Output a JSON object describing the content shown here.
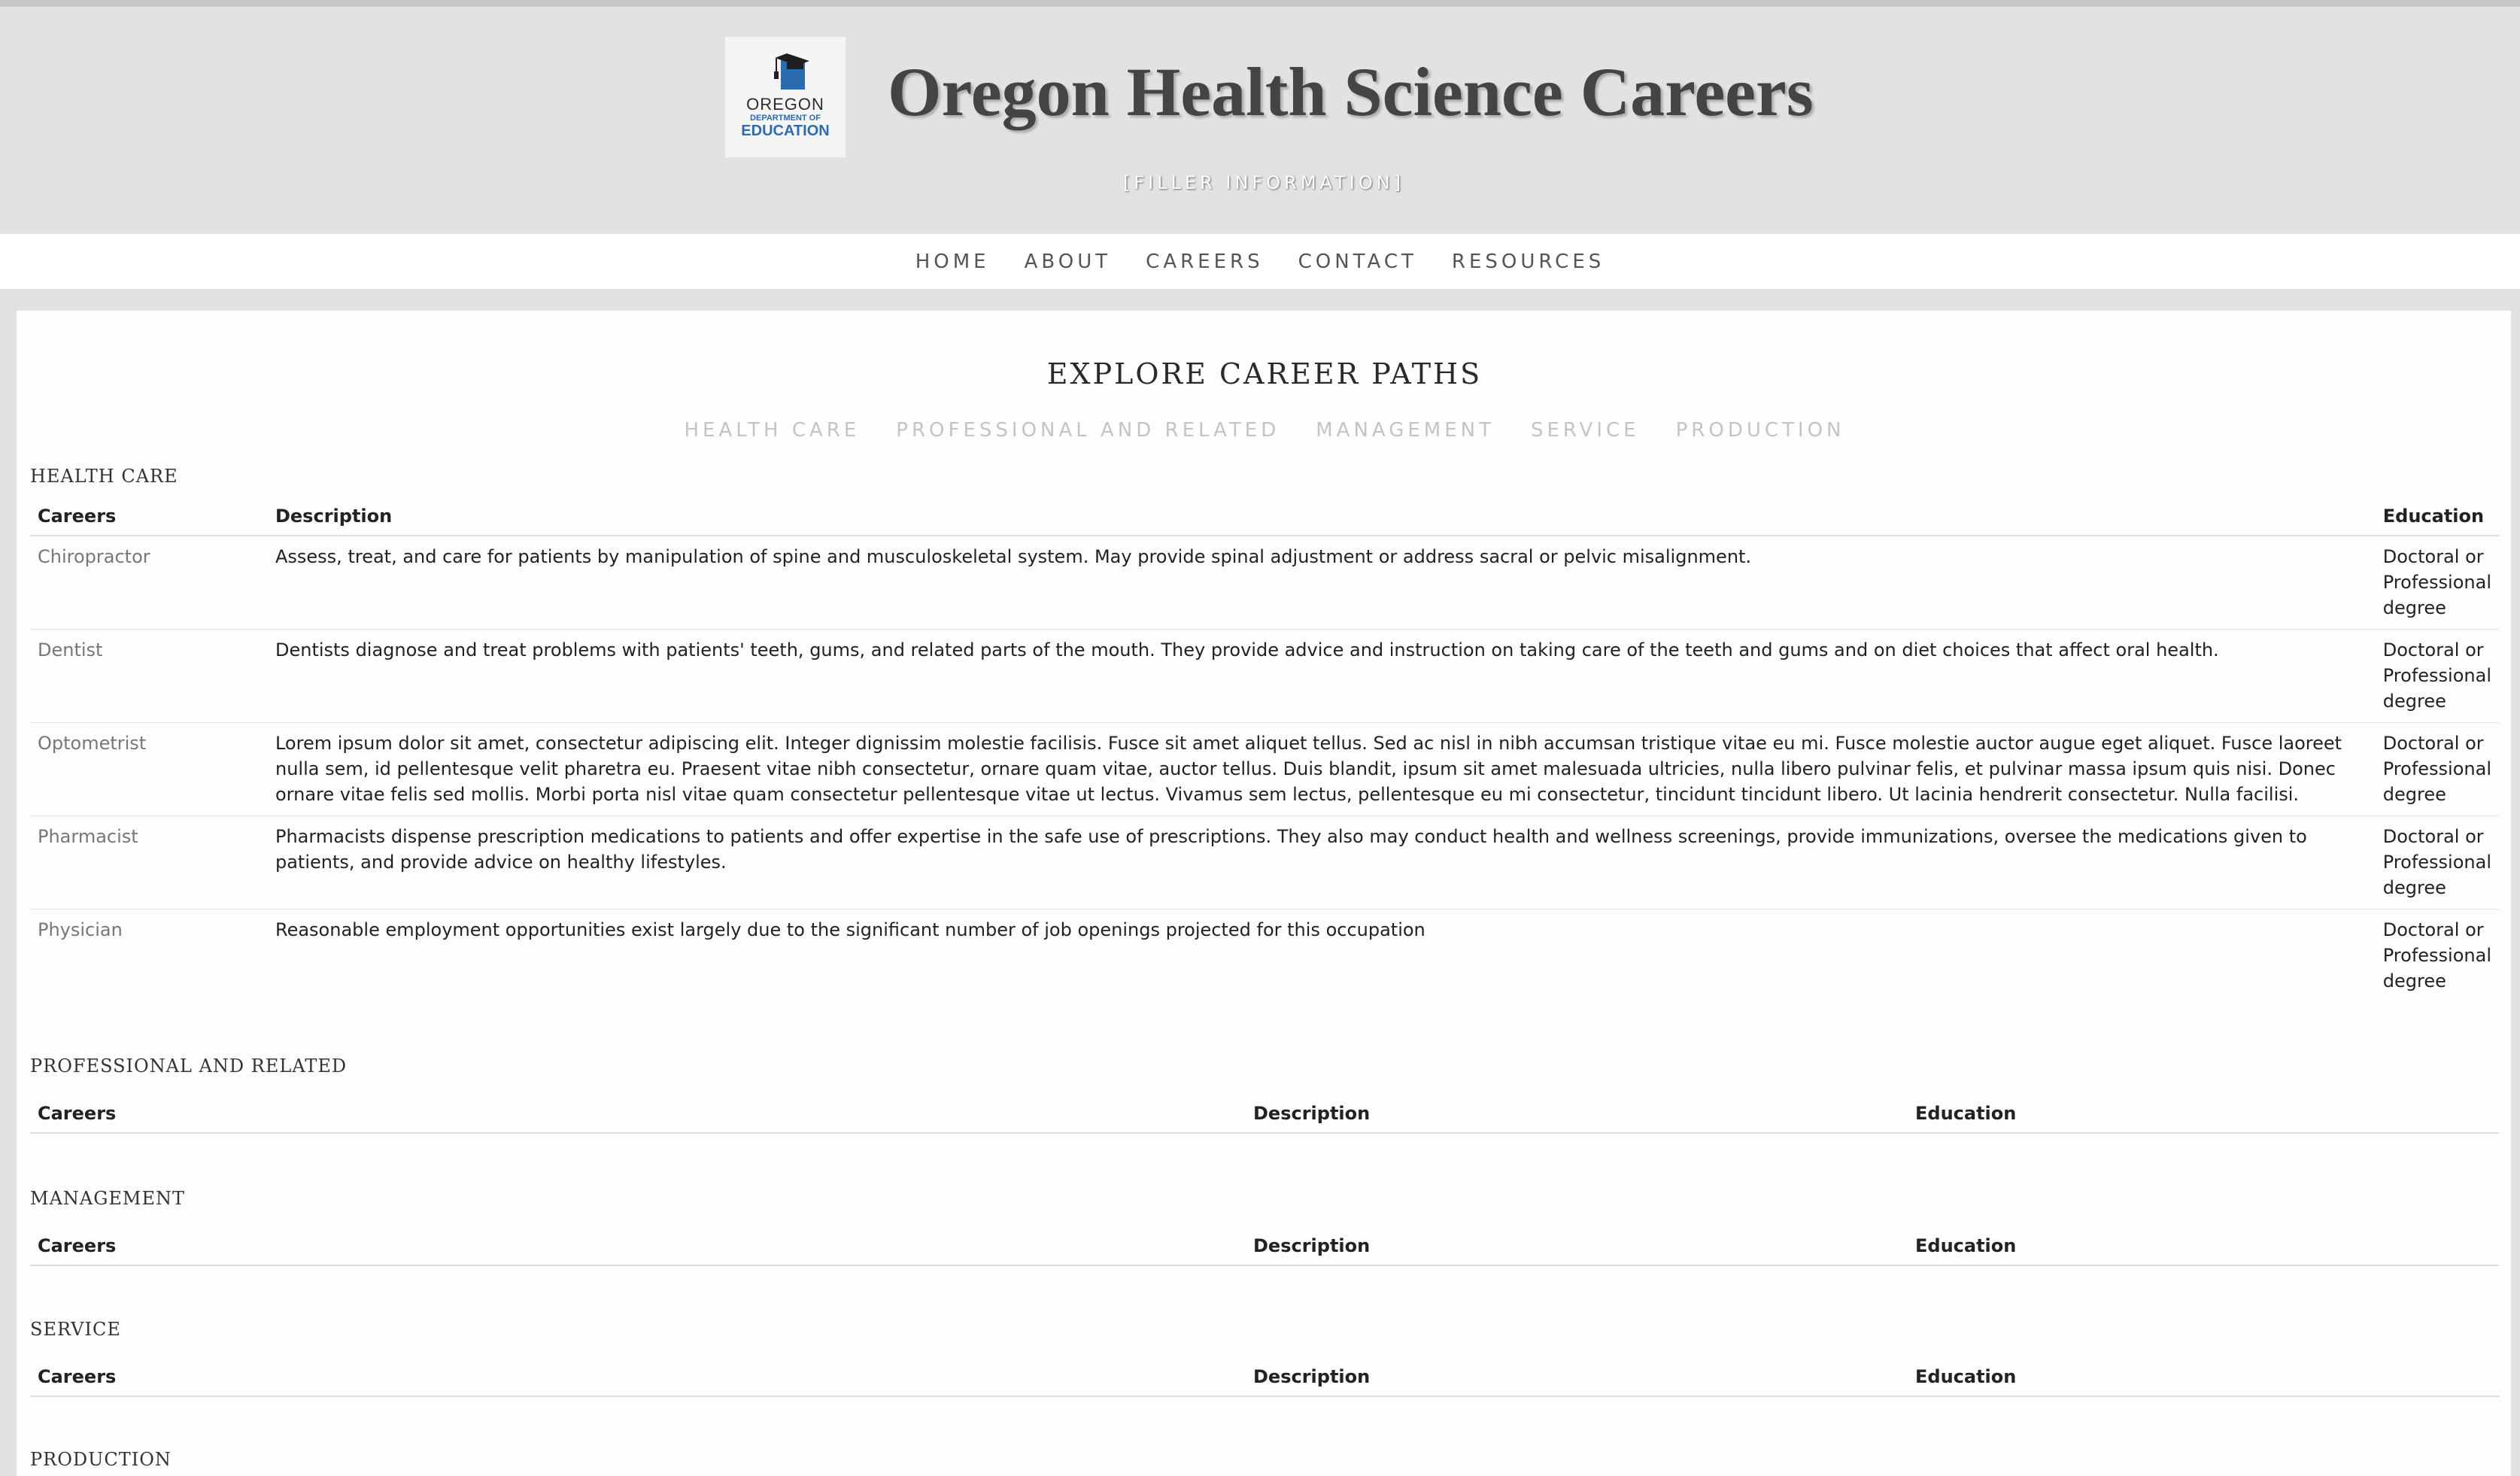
{
  "header": {
    "logo": {
      "line1": "OREGON",
      "line2": "DEPARTMENT OF",
      "line3": "EDUCATION"
    },
    "title": "Oregon Health Science Careers",
    "tagline": "[FILLER INFORMATION]"
  },
  "nav": {
    "items": [
      "HOME",
      "ABOUT",
      "CAREERS",
      "CONTACT",
      "RESOURCES"
    ]
  },
  "main": {
    "title": "EXPLORE CAREER PATHS",
    "tabs": [
      "HEALTH CARE",
      "PROFESSIONAL AND RELATED",
      "MANAGEMENT",
      "SERVICE",
      "PRODUCTION"
    ],
    "columns": {
      "careers": "Careers",
      "description": "Description",
      "education": "Education"
    },
    "sections": [
      {
        "heading": "HEALTH CARE",
        "rows": [
          {
            "career": "Chiropractor",
            "description": "Assess, treat, and care for patients by manipulation of spine and musculoskeletal system. May provide spinal adjustment or address sacral or pelvic misalignment.",
            "education": "Doctoral or Professional degree"
          },
          {
            "career": "Dentist",
            "description": "Dentists diagnose and treat problems with patients' teeth, gums, and related parts of the mouth. They provide advice and instruction on taking care of the teeth and gums and on diet choices that affect oral health.",
            "education": "Doctoral or Professional degree"
          },
          {
            "career": "Optometrist",
            "description": "Lorem ipsum dolor sit amet, consectetur adipiscing elit. Integer dignissim molestie facilisis. Fusce sit amet aliquet tellus. Sed ac nisl in nibh accumsan tristique vitae eu mi. Fusce molestie auctor augue eget aliquet. Fusce laoreet nulla sem, id pellentesque velit pharetra eu. Praesent vitae nibh consectetur, ornare quam vitae, auctor tellus. Duis blandit, ipsum sit amet malesuada ultricies, nulla libero pulvinar felis, et pulvinar massa ipsum quis nisi. Donec ornare vitae felis sed mollis. Morbi porta nisl vitae quam consectetur pellentesque vitae ut lectus. Vivamus sem lectus, pellentesque eu mi consectetur, tincidunt tincidunt libero. Ut lacinia hendrerit consectetur. Nulla facilisi.",
            "education": "Doctoral or Professional degree"
          },
          {
            "career": "Pharmacist",
            "description": "Pharmacists dispense prescription medications to patients and offer expertise in the safe use of prescriptions. They also may conduct health and wellness screenings, provide immunizations, oversee the medications given to patients, and provide advice on healthy lifestyles.",
            "education": "Doctoral or Professional degree"
          },
          {
            "career": "Physician",
            "description": "Reasonable employment opportunities exist largely due to the significant number of job openings projected for this occupation",
            "education": "Doctoral or Professional degree"
          }
        ]
      },
      {
        "heading": "PROFESSIONAL AND RELATED",
        "rows": []
      },
      {
        "heading": "MANAGEMENT",
        "rows": []
      },
      {
        "heading": "SERVICE",
        "rows": []
      },
      {
        "heading": "PRODUCTION",
        "rows": []
      }
    ]
  },
  "colors": {
    "header_bg": "#e2e2e2",
    "title_text": "#444444",
    "logo_blue": "#2b6cb0",
    "tab_inactive": "#c4c4c4",
    "career_link": "#777777"
  }
}
